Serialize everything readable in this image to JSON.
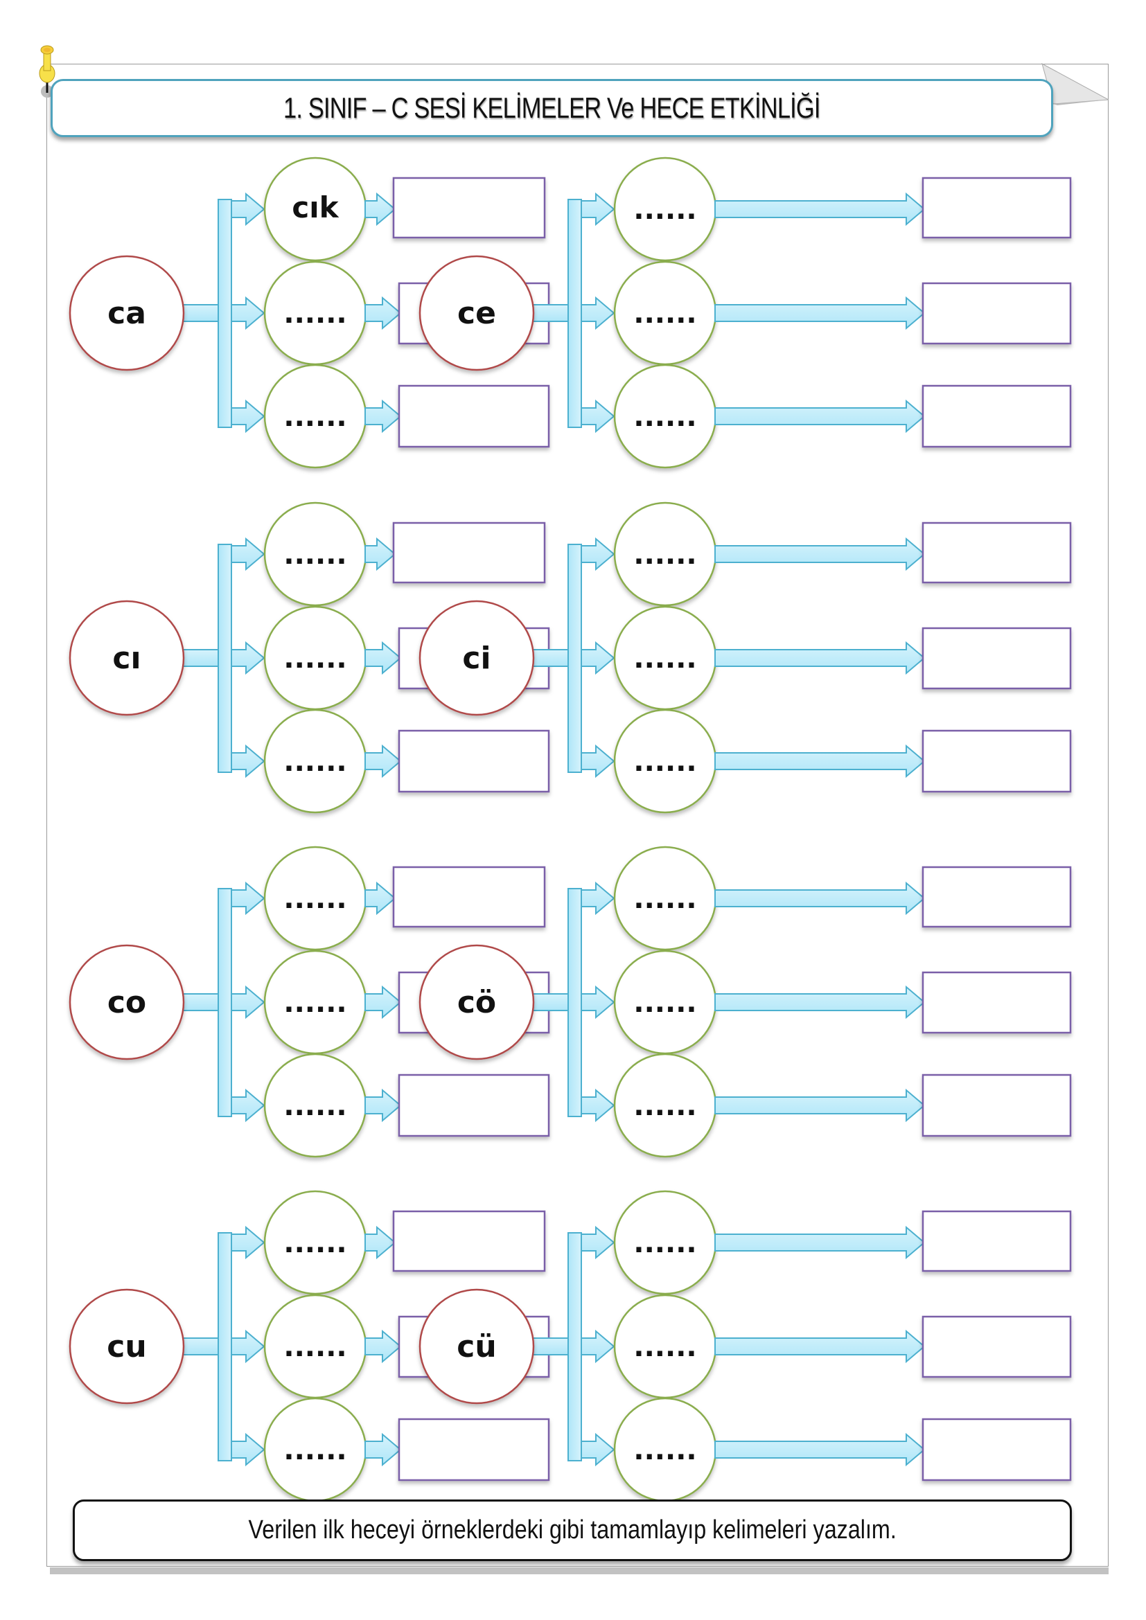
{
  "title": "1. SINIF – C SESİ KELİMELER Ve HECE ETKİNLİĞİ",
  "instruction": "Verilen ilk heceyi örneklerdeki gibi tamamlayıp kelimeleri yazalım.",
  "colors": {
    "title_border": "#4fa3bd",
    "start_circle_border": "#b04a4a",
    "syllable_circle_border": "#8aad4e",
    "answer_box_border": "#7a5ea8",
    "arrow_fill": "#bfeafa",
    "arrow_stroke": "#4cb0cf",
    "pin": "#f7e04a"
  },
  "groups": [
    {
      "start": "ca",
      "syllables": [
        "cık",
        "......",
        "......"
      ],
      "answers": [
        "",
        "",
        ""
      ]
    },
    {
      "start": "ce",
      "syllables": [
        "......",
        "......",
        "......"
      ],
      "answers": [
        "",
        "",
        ""
      ]
    },
    {
      "start": "cı",
      "syllables": [
        "......",
        "......",
        "......"
      ],
      "answers": [
        "",
        "",
        ""
      ]
    },
    {
      "start": "ci",
      "syllables": [
        "......",
        "......",
        "......"
      ],
      "answers": [
        "",
        "",
        ""
      ]
    },
    {
      "start": "co",
      "syllables": [
        "......",
        "......",
        "......"
      ],
      "answers": [
        "",
        "",
        ""
      ]
    },
    {
      "start": "cö",
      "syllables": [
        "......",
        "......",
        "......"
      ],
      "answers": [
        "",
        "",
        ""
      ]
    },
    {
      "start": "cu",
      "syllables": [
        "......",
        "......",
        "......"
      ],
      "answers": [
        "",
        "",
        ""
      ]
    },
    {
      "start": "cü",
      "syllables": [
        "......",
        "......",
        "......"
      ],
      "answers": [
        "",
        "",
        ""
      ]
    }
  ]
}
